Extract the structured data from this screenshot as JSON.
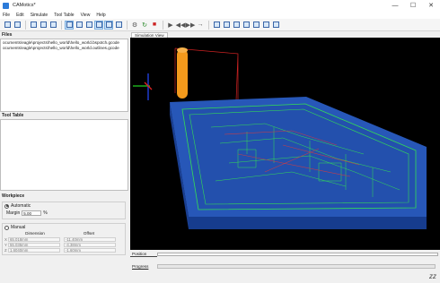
{
  "window": {
    "title": "CAMotics*",
    "controls": [
      "—",
      "☐",
      "✕"
    ]
  },
  "menu": [
    "File",
    "Edit",
    "Simulate",
    "Tool Table",
    "View",
    "Help"
  ],
  "files": {
    "header": "Files",
    "items": [
      "ocuments\\eagle\\projects\\hello_world\\hello_world.bspotch.gcode",
      "ocuments\\eagle\\projects\\hello_world\\hello_world.outlines.gcode"
    ]
  },
  "tool_table": {
    "header": "Tool Table"
  },
  "workpiece": {
    "header": "Workpiece",
    "automatic_label": "Automatic",
    "margin_label": "Margin",
    "margin_value": "5.00",
    "margin_unit": "%",
    "manual_label": "Manual",
    "dimension_label": "Dimension",
    "offset_label": "Offset",
    "rows": [
      {
        "axis": "X",
        "dimension": "65.018mm",
        "offset": "-11.40mm"
      },
      {
        "axis": "Y",
        "dimension": "55.035mm",
        "offset": "-4.38mm"
      },
      {
        "axis": "Z",
        "dimension": "1.6040mm",
        "offset": "-1.60mm"
      }
    ]
  },
  "viewport": {
    "tab_label": "Simulation View"
  },
  "position": {
    "label": "Position"
  },
  "progress": {
    "label": "Progress"
  },
  "status_icon": "zz",
  "colors": {
    "board": "#1e4aa6",
    "board_top": "#2757b8",
    "trace_green": "#33dd55",
    "trace_red": "#c43d4a",
    "tool": "#f39a1c"
  }
}
